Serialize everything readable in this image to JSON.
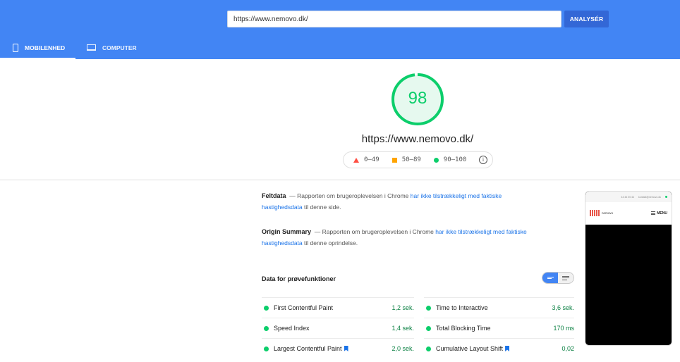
{
  "header": {
    "url_value": "https://www.nemovo.dk/",
    "analyze_label": "ANALYSÉR",
    "tabs": [
      {
        "label": "MOBILENHED",
        "icon": "mobile-phone-icon",
        "active": true
      },
      {
        "label": "COMPUTER",
        "icon": "laptop-icon",
        "active": false
      }
    ]
  },
  "score": {
    "value": "98",
    "fraction": 0.98,
    "url": "https://www.nemovo.dk/",
    "color": "#0cce6b",
    "legend": [
      {
        "label": "0–49",
        "icon": "red-triangle-icon",
        "color": "#ff4e42"
      },
      {
        "label": "50–89",
        "icon": "orange-square-icon",
        "color": "#ffa400"
      },
      {
        "label": "90–100",
        "icon": "green-circle-icon",
        "color": "#0cce6b"
      }
    ],
    "info_icon": "i"
  },
  "field_data": {
    "title": "Feltdata",
    "text_before": "— Rapporten om brugeroplevelsen i Chrome",
    "link": "har ikke tilstrækkeligt med faktiske hastighedsdata",
    "text_after": "til denne side."
  },
  "origin_summary": {
    "title": "Origin Summary",
    "text_before": "— Rapporten om brugeroplevelsen i Chrome",
    "link": "har ikke tilstrækkeligt med faktiske hastighedsdata",
    "text_after": "til denne oprindelse."
  },
  "lab": {
    "title": "Data for prøvefunktioner",
    "metrics_left": [
      {
        "name": "First Contentful Paint",
        "value": "1,2 sek.",
        "flag": false
      },
      {
        "name": "Speed Index",
        "value": "1,4 sek.",
        "flag": false
      },
      {
        "name": "Largest Contentful Paint",
        "value": "2,0 sek.",
        "flag": true
      }
    ],
    "metrics_right": [
      {
        "name": "Time to Interactive",
        "value": "3,6 sek.",
        "flag": false
      },
      {
        "name": "Total Blocking Time",
        "value": "170 ms",
        "flag": false
      },
      {
        "name": "Cumulative Layout Shift",
        "value": "0,02",
        "flag": true
      }
    ]
  },
  "preview": {
    "phone_text": "44 44 00 44",
    "email_text": "kontakt@nemovo.dk",
    "logo_text": "nemovo",
    "menu_label": "MENU"
  }
}
